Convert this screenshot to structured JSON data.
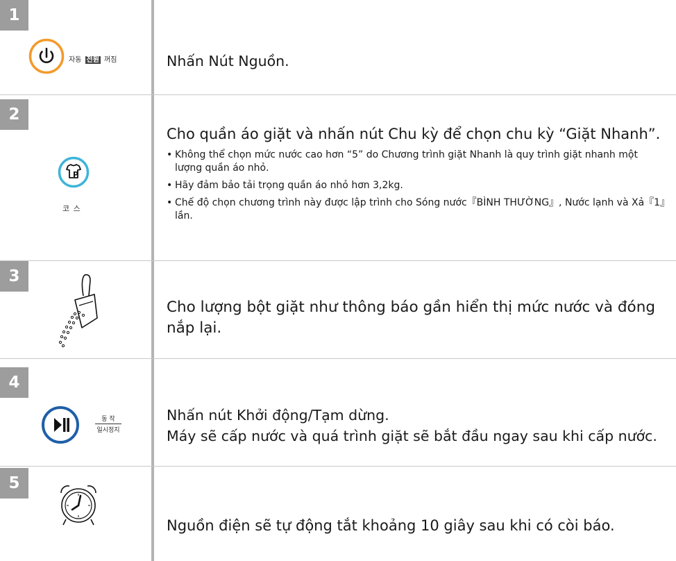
{
  "steps": [
    {
      "number": "1",
      "icon_label_pre": "자동",
      "icon_label_box": "전원",
      "icon_label_post": "꺼짐",
      "text": "Nhấn Nút Nguồn."
    },
    {
      "number": "2",
      "icon_label": "코 스",
      "text": "Cho quần áo giặt và nhấn nút Chu kỳ để chọn chu kỳ “Giặt Nhanh”.",
      "notes": [
        "Không thể chọn mức nước cao hơn “5” do Chương trình giặt Nhanh là quy trình giặt nhanh một lượng quần áo nhỏ.",
        "Hãy đảm bảo tải trọng quần áo nhỏ hơn 3,2kg.",
        "Chế độ chọn chương trình này được lập trình cho Sóng nước『BÌNH THƯỜNG』, Nước lạnh và Xả『1』lần."
      ]
    },
    {
      "number": "3",
      "text": "Cho lượng bột giặt như thông báo gần hiển thị mức nước và đóng nắp lại."
    },
    {
      "number": "4",
      "icon_label_top": "동 작",
      "icon_label_bottom": "일시정지",
      "text_line1": "Nhấn nút Khởi động/Tạm dừng.",
      "text_line2": "Máy sẽ cấp nước và quá trình giặt sẽ bắt đầu ngay sau khi cấp nước."
    },
    {
      "number": "5",
      "text": "Nguồn điện sẽ tự động tắt khoảng 10 giây sau khi có còi báo."
    }
  ],
  "colors": {
    "power_ring": "#f39a2c",
    "course_ring": "#3fb4d8",
    "start_ring": "#1f5fa8",
    "badge": "#9d9d9d"
  }
}
